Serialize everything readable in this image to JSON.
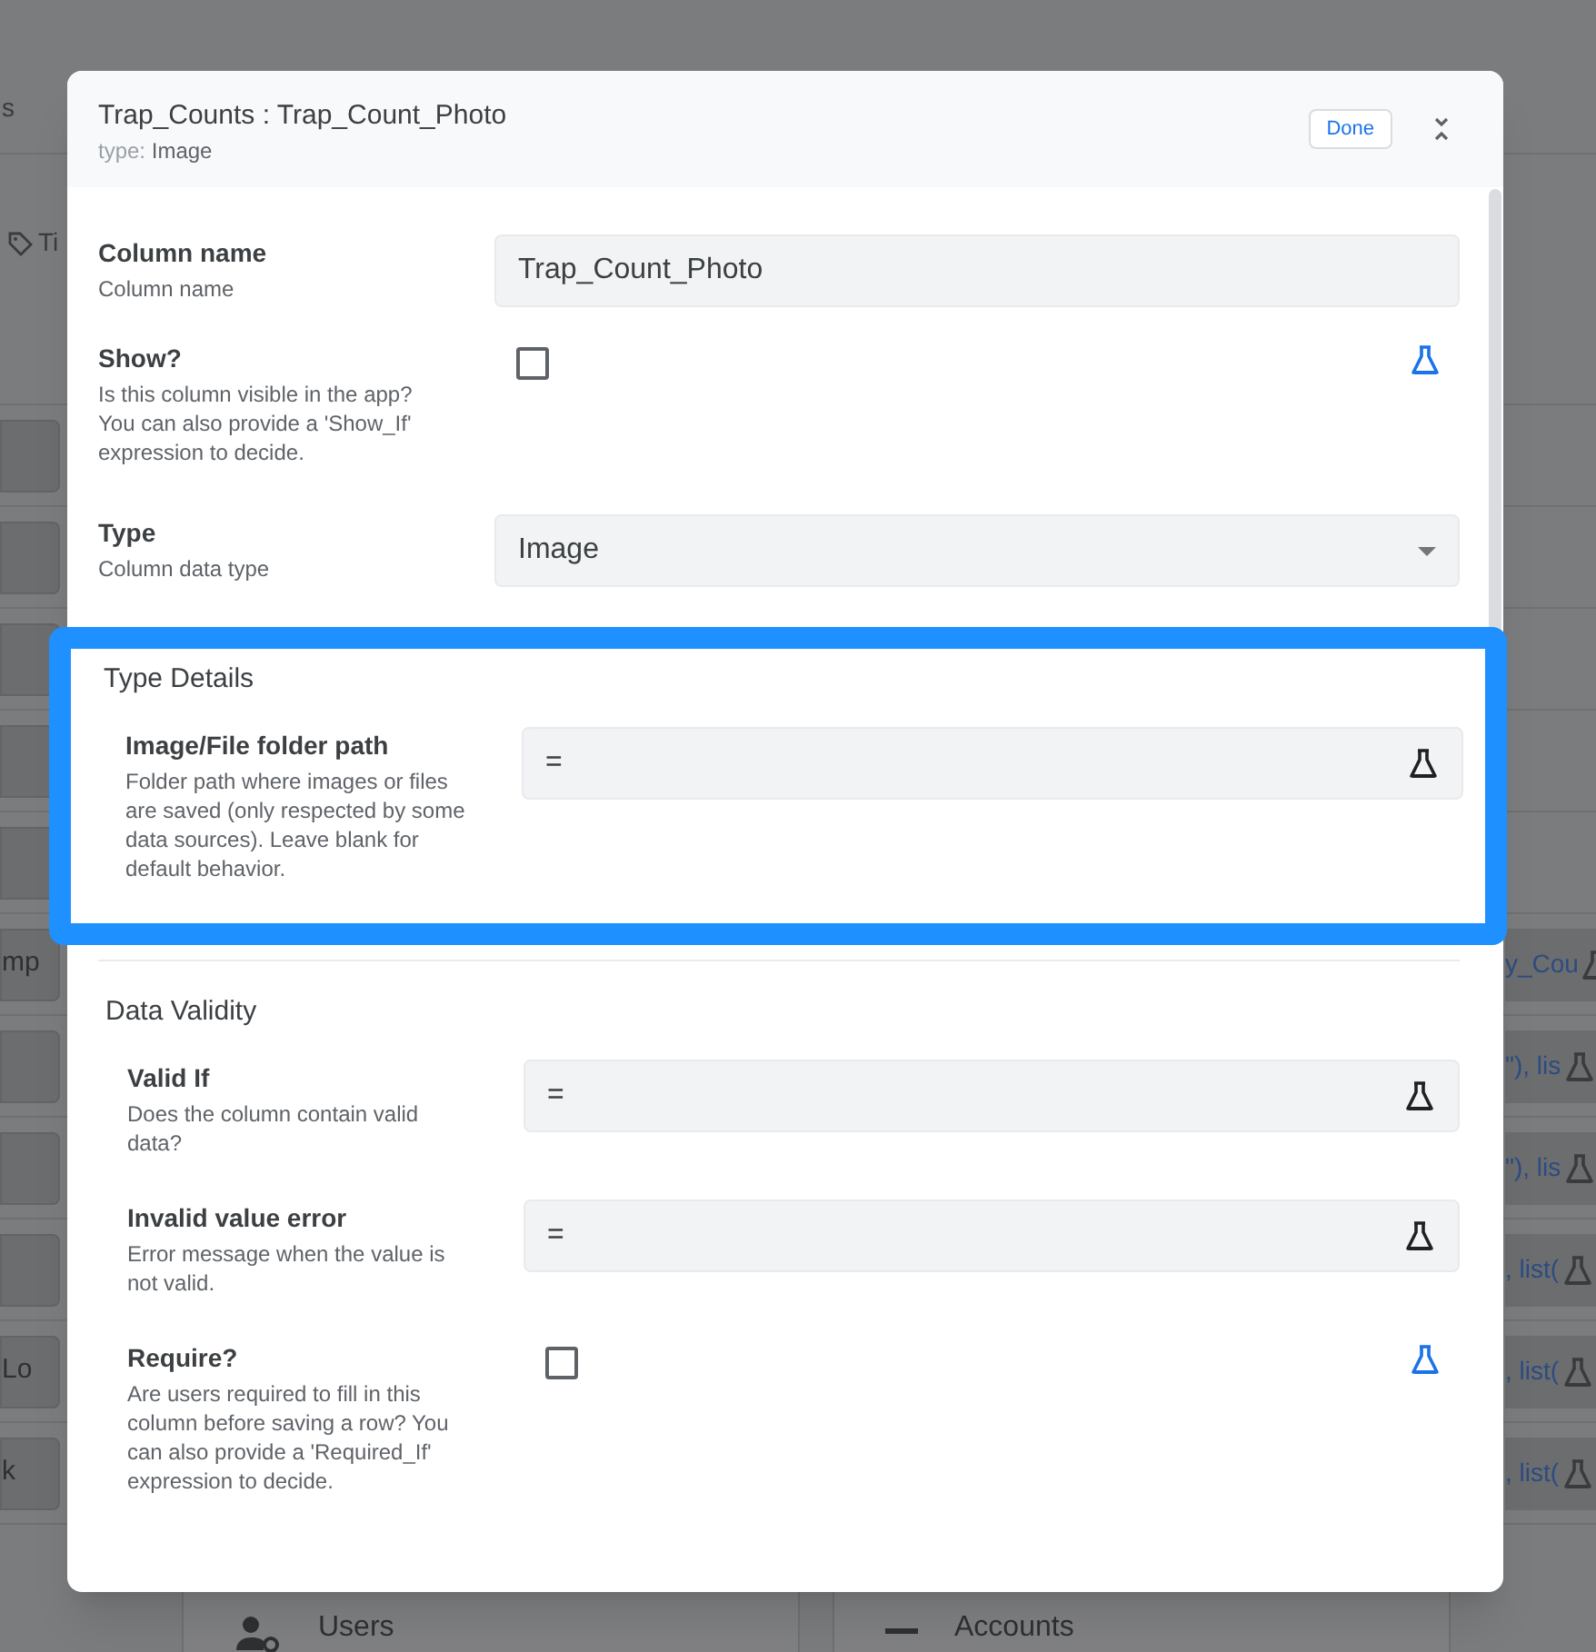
{
  "background": {
    "header_text": "s",
    "tag": "Ti",
    "rows": [
      {
        "left": "mp",
        "right": "y_Cou"
      },
      {
        "right": "\"), lis"
      },
      {
        "right": "\"), lis"
      },
      {
        "right": ", list("
      },
      {
        "left": "Lo",
        "right": ", list("
      },
      {
        "left": "k",
        "right": ", list("
      }
    ],
    "cards": [
      {
        "kind": "users",
        "label": "Users"
      },
      {
        "kind": "accounts",
        "label": "Accounts"
      }
    ]
  },
  "dialog": {
    "title": "Trap_Counts : Trap_Count_Photo",
    "type_label": "type:",
    "type_value": "Image",
    "done": "Done",
    "fields": [
      {
        "kind": "text",
        "label": "Column name",
        "description": "Column name",
        "value": "Trap_Count_Photo"
      },
      {
        "kind": "checkbox",
        "label": "Show?",
        "description": "Is this column visible in the app? You can also provide a 'Show_If' expression to decide.",
        "checked": false
      },
      {
        "kind": "select",
        "label": "Type",
        "description": "Column data type",
        "value": "Image"
      }
    ],
    "sections": [
      {
        "title": "Type Details",
        "highlighted": true,
        "fields": [
          {
            "kind": "formula",
            "label": "Image/File folder path",
            "description": "Folder path where images or files are saved (only respected by some data sources). Leave blank for default behavior.",
            "value": "="
          }
        ]
      },
      {
        "title": "Data Validity",
        "highlighted": false,
        "fields": [
          {
            "kind": "formula",
            "label": "Valid If",
            "description": "Does the column contain valid data?",
            "value": "="
          },
          {
            "kind": "formula",
            "label": "Invalid value error",
            "description": "Error message when the value is not valid.",
            "value": "="
          },
          {
            "kind": "checkbox",
            "label": "Require?",
            "description": "Are users required to fill in this column before saving a row? You can also provide a 'Required_If' expression to decide.",
            "checked": false
          }
        ]
      }
    ]
  }
}
